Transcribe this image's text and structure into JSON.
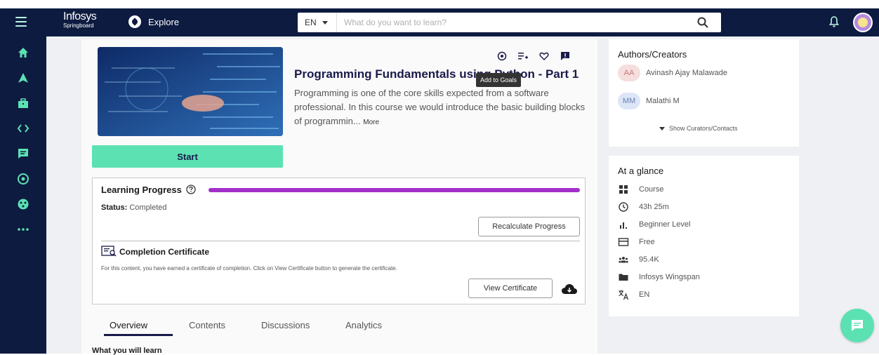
{
  "header": {
    "logo_line1": "Infosys",
    "logo_line2": "Springboard",
    "explore_label": "Explore",
    "lang_selected": "EN",
    "search_placeholder": "What do you want to learn?"
  },
  "rail_icons": [
    "home-icon",
    "navigate-icon",
    "briefcase-icon",
    "code-icon",
    "chat-icon",
    "target-icon",
    "palette-icon",
    "more-icon"
  ],
  "course": {
    "title": "Programming Fundamentals using Python - Part 1",
    "description": "Programming is one of the core skills expected from a software professional. In this course we would introduce the basic building blocks of programmin...",
    "more_label": "More",
    "tooltip": "Add to Goals",
    "start_label": "Start"
  },
  "progress": {
    "title": "Learning Progress",
    "status_label": "Status:",
    "status_value": "Completed",
    "percent": 100,
    "recalc_label": "Recalculate Progress",
    "bar_color": "#a330c9"
  },
  "certificate": {
    "title": "Completion Certificate",
    "description": "For this content, you have earned a certificate of completion. Click on View Certificate button to generate the certificate.",
    "view_label": "View Certificate"
  },
  "tabs": [
    {
      "label": "Overview",
      "active": true
    },
    {
      "label": "Contents",
      "active": false
    },
    {
      "label": "Discussions",
      "active": false
    },
    {
      "label": "Analytics",
      "active": false
    }
  ],
  "learn_heading": "What you will learn",
  "authors": {
    "title": "Authors/Creators",
    "list": [
      {
        "initials": "AA",
        "name": "Avinash Ajay Malawade",
        "bg": "#f6dede",
        "fg": "#c47a7a"
      },
      {
        "initials": "MM",
        "name": "Malathi M",
        "bg": "#dde6f7",
        "fg": "#6a7fb0"
      }
    ],
    "show_curators": "Show Curators/Contacts"
  },
  "glance": {
    "title": "At a glance",
    "items": [
      {
        "icon": "course-icon",
        "text": "Course"
      },
      {
        "icon": "clock-icon",
        "text": "43h 25m"
      },
      {
        "icon": "level-icon",
        "text": "Beginner Level"
      },
      {
        "icon": "card-icon",
        "text": "Free"
      },
      {
        "icon": "users-icon",
        "text": "95.4K"
      },
      {
        "icon": "folder-icon",
        "text": "Infosys Wingspan"
      },
      {
        "icon": "translate-icon",
        "text": "EN"
      }
    ]
  },
  "colors": {
    "nav_bg": "#0d1b40",
    "accent": "#5ce1b3",
    "rail_icon": "#5ce1b3"
  }
}
